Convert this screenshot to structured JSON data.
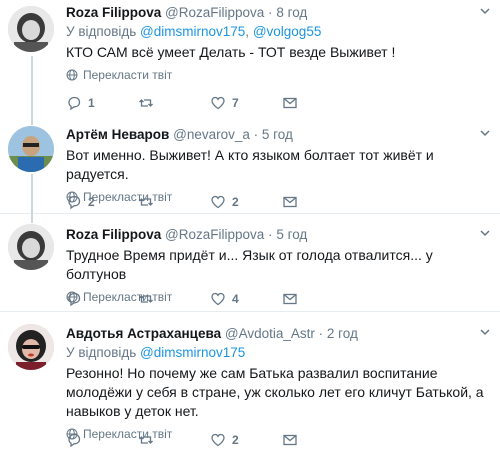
{
  "tweets": [
    {
      "name": "Roza Filippova",
      "handle": "@RozaFilippova",
      "sep": "·",
      "time": "8 год",
      "reply_prefix": "У відповідь",
      "reply_user1": "@dimsmirnov175",
      "reply_sep": ",",
      "reply_user2": "@volgog55",
      "text": "КТО САМ всё умеет Делать - ТОТ  везде Выживет !",
      "translate": "Перекласти твіт",
      "replies": "1",
      "retweets": "",
      "likes": "7"
    },
    {
      "name": "Артём Неваров",
      "handle": "@nevarov_a",
      "sep": "·",
      "time": "5 год",
      "text": "Вот именно. Выживет! А кто языком болтает тот живёт и радуется.",
      "translate": "Перекласти твіт",
      "replies": "2",
      "retweets": "",
      "likes": "2"
    },
    {
      "name": "Roza Filippova",
      "handle": "@RozaFilippova",
      "sep": "·",
      "time": "5 год",
      "text": "Трудное Время придёт и... Язык от голода  отвалится... у болтунов",
      "translate": "Перекласти твіт",
      "replies": "",
      "retweets": "",
      "likes": "4"
    },
    {
      "name": "Авдотья Астраханцева",
      "handle": "@Avdotia_Astr",
      "sep": "·",
      "time": "2 год",
      "reply_prefix": "У відповідь",
      "reply_user1": "@dimsmirnov175",
      "text": "Резонно! Но почему же сам Батька развалил воспитание молодёжи у себя в стране, уж сколько лет его кличут Батькой, а навыков у деток нет.",
      "translate": "Перекласти твіт",
      "replies": "",
      "retweets": "",
      "likes": "2"
    }
  ],
  "colors": {
    "link": "#1b95e0",
    "muted": "#657786",
    "text": "#14171a",
    "border": "#e6ecf0",
    "thread_line": "#ccd6dd"
  }
}
